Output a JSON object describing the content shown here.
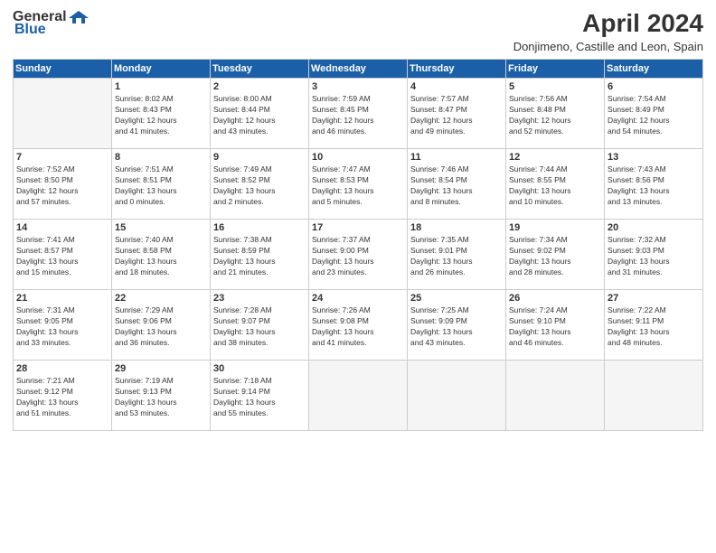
{
  "header": {
    "logo_general": "General",
    "logo_blue": "Blue",
    "title": "April 2024",
    "location": "Donjimeno, Castille and Leon, Spain"
  },
  "weekdays": [
    "Sunday",
    "Monday",
    "Tuesday",
    "Wednesday",
    "Thursday",
    "Friday",
    "Saturday"
  ],
  "weeks": [
    [
      {
        "day": "",
        "info": ""
      },
      {
        "day": "1",
        "info": "Sunrise: 8:02 AM\nSunset: 8:43 PM\nDaylight: 12 hours\nand 41 minutes."
      },
      {
        "day": "2",
        "info": "Sunrise: 8:00 AM\nSunset: 8:44 PM\nDaylight: 12 hours\nand 43 minutes."
      },
      {
        "day": "3",
        "info": "Sunrise: 7:59 AM\nSunset: 8:45 PM\nDaylight: 12 hours\nand 46 minutes."
      },
      {
        "day": "4",
        "info": "Sunrise: 7:57 AM\nSunset: 8:47 PM\nDaylight: 12 hours\nand 49 minutes."
      },
      {
        "day": "5",
        "info": "Sunrise: 7:56 AM\nSunset: 8:48 PM\nDaylight: 12 hours\nand 52 minutes."
      },
      {
        "day": "6",
        "info": "Sunrise: 7:54 AM\nSunset: 8:49 PM\nDaylight: 12 hours\nand 54 minutes."
      }
    ],
    [
      {
        "day": "7",
        "info": "Sunrise: 7:52 AM\nSunset: 8:50 PM\nDaylight: 12 hours\nand 57 minutes."
      },
      {
        "day": "8",
        "info": "Sunrise: 7:51 AM\nSunset: 8:51 PM\nDaylight: 13 hours\nand 0 minutes."
      },
      {
        "day": "9",
        "info": "Sunrise: 7:49 AM\nSunset: 8:52 PM\nDaylight: 13 hours\nand 2 minutes."
      },
      {
        "day": "10",
        "info": "Sunrise: 7:47 AM\nSunset: 8:53 PM\nDaylight: 13 hours\nand 5 minutes."
      },
      {
        "day": "11",
        "info": "Sunrise: 7:46 AM\nSunset: 8:54 PM\nDaylight: 13 hours\nand 8 minutes."
      },
      {
        "day": "12",
        "info": "Sunrise: 7:44 AM\nSunset: 8:55 PM\nDaylight: 13 hours\nand 10 minutes."
      },
      {
        "day": "13",
        "info": "Sunrise: 7:43 AM\nSunset: 8:56 PM\nDaylight: 13 hours\nand 13 minutes."
      }
    ],
    [
      {
        "day": "14",
        "info": "Sunrise: 7:41 AM\nSunset: 8:57 PM\nDaylight: 13 hours\nand 15 minutes."
      },
      {
        "day": "15",
        "info": "Sunrise: 7:40 AM\nSunset: 8:58 PM\nDaylight: 13 hours\nand 18 minutes."
      },
      {
        "day": "16",
        "info": "Sunrise: 7:38 AM\nSunset: 8:59 PM\nDaylight: 13 hours\nand 21 minutes."
      },
      {
        "day": "17",
        "info": "Sunrise: 7:37 AM\nSunset: 9:00 PM\nDaylight: 13 hours\nand 23 minutes."
      },
      {
        "day": "18",
        "info": "Sunrise: 7:35 AM\nSunset: 9:01 PM\nDaylight: 13 hours\nand 26 minutes."
      },
      {
        "day": "19",
        "info": "Sunrise: 7:34 AM\nSunset: 9:02 PM\nDaylight: 13 hours\nand 28 minutes."
      },
      {
        "day": "20",
        "info": "Sunrise: 7:32 AM\nSunset: 9:03 PM\nDaylight: 13 hours\nand 31 minutes."
      }
    ],
    [
      {
        "day": "21",
        "info": "Sunrise: 7:31 AM\nSunset: 9:05 PM\nDaylight: 13 hours\nand 33 minutes."
      },
      {
        "day": "22",
        "info": "Sunrise: 7:29 AM\nSunset: 9:06 PM\nDaylight: 13 hours\nand 36 minutes."
      },
      {
        "day": "23",
        "info": "Sunrise: 7:28 AM\nSunset: 9:07 PM\nDaylight: 13 hours\nand 38 minutes."
      },
      {
        "day": "24",
        "info": "Sunrise: 7:26 AM\nSunset: 9:08 PM\nDaylight: 13 hours\nand 41 minutes."
      },
      {
        "day": "25",
        "info": "Sunrise: 7:25 AM\nSunset: 9:09 PM\nDaylight: 13 hours\nand 43 minutes."
      },
      {
        "day": "26",
        "info": "Sunrise: 7:24 AM\nSunset: 9:10 PM\nDaylight: 13 hours\nand 46 minutes."
      },
      {
        "day": "27",
        "info": "Sunrise: 7:22 AM\nSunset: 9:11 PM\nDaylight: 13 hours\nand 48 minutes."
      }
    ],
    [
      {
        "day": "28",
        "info": "Sunrise: 7:21 AM\nSunset: 9:12 PM\nDaylight: 13 hours\nand 51 minutes."
      },
      {
        "day": "29",
        "info": "Sunrise: 7:19 AM\nSunset: 9:13 PM\nDaylight: 13 hours\nand 53 minutes."
      },
      {
        "day": "30",
        "info": "Sunrise: 7:18 AM\nSunset: 9:14 PM\nDaylight: 13 hours\nand 55 minutes."
      },
      {
        "day": "",
        "info": ""
      },
      {
        "day": "",
        "info": ""
      },
      {
        "day": "",
        "info": ""
      },
      {
        "day": "",
        "info": ""
      }
    ]
  ]
}
